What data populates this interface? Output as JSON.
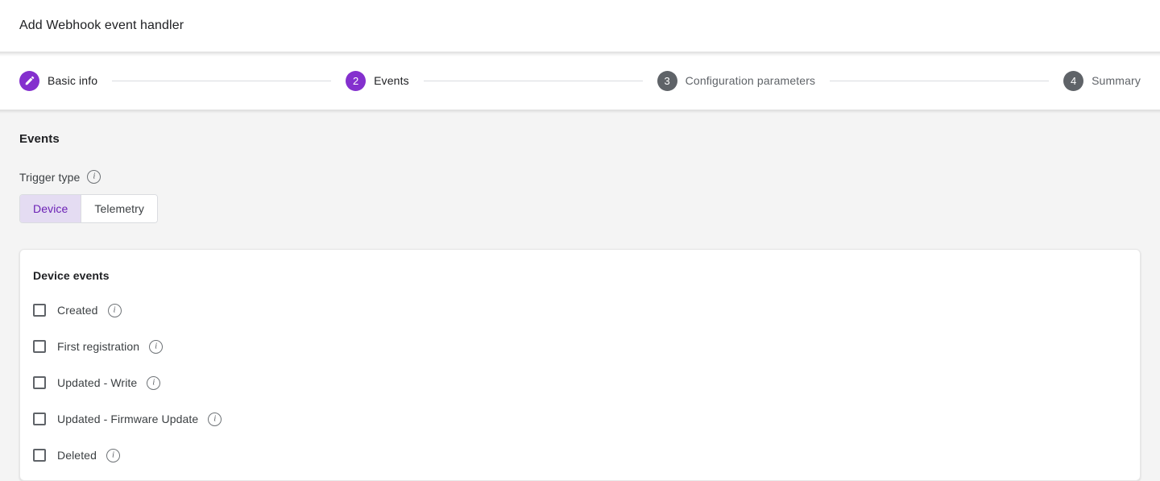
{
  "header": {
    "title": "Add Webhook event handler"
  },
  "stepper": {
    "steps": [
      {
        "badge": "pencil-icon",
        "label": "Basic info",
        "state": "done"
      },
      {
        "badge": "2",
        "label": "Events",
        "state": "active"
      },
      {
        "badge": "3",
        "label": "Configuration parameters",
        "state": "idle"
      },
      {
        "badge": "4",
        "label": "Summary",
        "state": "idle"
      }
    ]
  },
  "main": {
    "section_title": "Events",
    "trigger_type": {
      "label": "Trigger type",
      "info_icon": "info-icon",
      "options": [
        {
          "label": "Device",
          "selected": true
        },
        {
          "label": "Telemetry",
          "selected": false
        }
      ]
    },
    "events_card": {
      "title": "Device events",
      "items": [
        {
          "label": "Created",
          "checked": false,
          "info_icon": "info-icon"
        },
        {
          "label": "First registration",
          "checked": false,
          "info_icon": "info-icon"
        },
        {
          "label": "Updated - Write",
          "checked": false,
          "info_icon": "info-icon"
        },
        {
          "label": "Updated - Firmware Update",
          "checked": false,
          "info_icon": "info-icon"
        },
        {
          "label": "Deleted",
          "checked": false,
          "info_icon": "info-icon"
        }
      ]
    }
  },
  "colors": {
    "accent_purple": "#8430ce",
    "selected_toggle_bg": "#e4dcf2",
    "selected_toggle_text": "#6b21b5",
    "idle_badge": "#5f6368",
    "page_bg": "#f4f4f4"
  }
}
